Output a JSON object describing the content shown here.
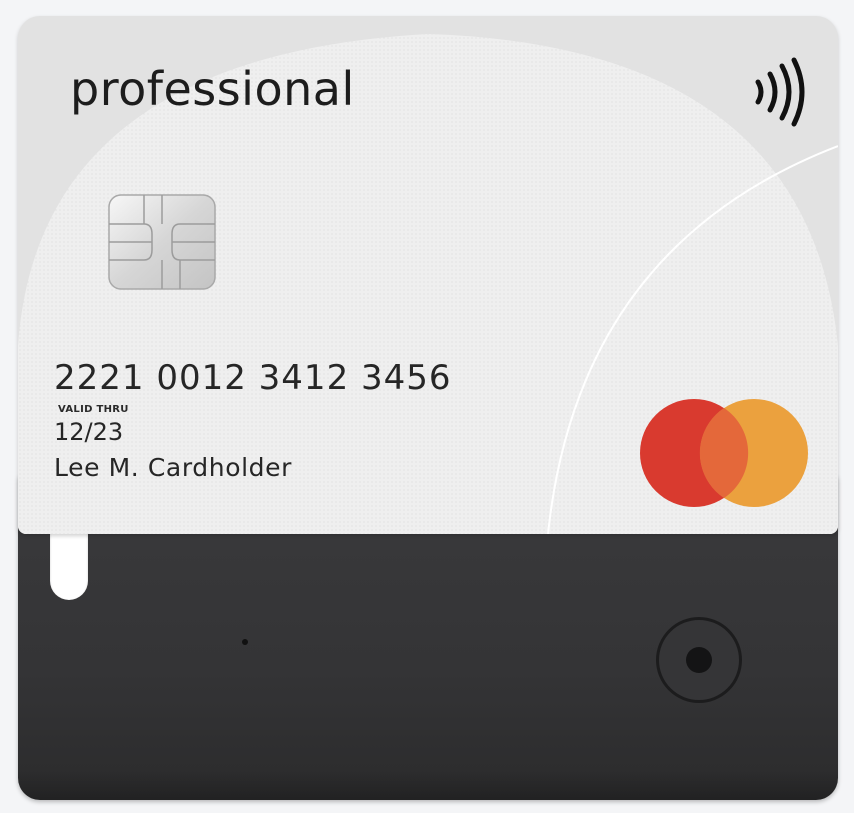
{
  "card": {
    "brand_text": "professional",
    "number": "2221 0012 3412 3456",
    "valid_thru_label": "VALID THRU",
    "expiry": "12/23",
    "cardholder": "Lee M. Cardholder",
    "network_logo": "mastercard-logo",
    "contactless_icon": "contactless-icon",
    "chip_icon": "emv-chip-icon"
  },
  "colors": {
    "background": "#f4f5f7",
    "card_silver": "#e2e2e2",
    "reader_body": "#363638",
    "mc_red": "#d93a2f",
    "mc_orange": "#eba13e",
    "mc_overlap": "#e4683a"
  }
}
